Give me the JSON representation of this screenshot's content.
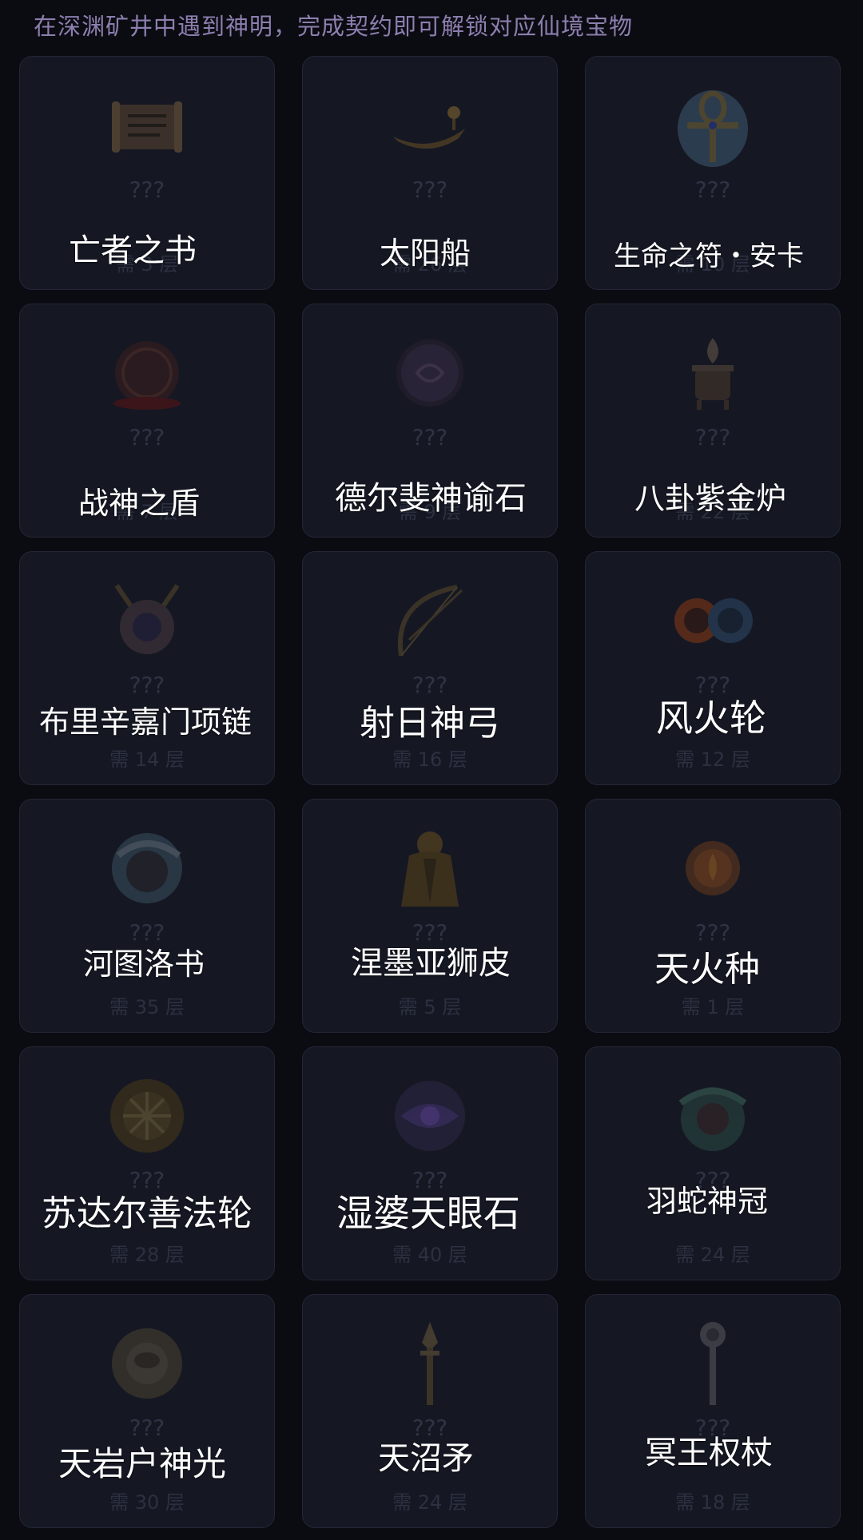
{
  "subtitle": "在深渊矿井中遇到神明，完成契约即可解锁对应仙境宝物",
  "items": [
    {
      "name": "亡者之书",
      "hidden": "???",
      "requirement": "需 3 层",
      "icon": "scroll-icon"
    },
    {
      "name": "太阳船",
      "hidden": "???",
      "requirement": "需 26 层",
      "icon": "sun-boat-icon"
    },
    {
      "name": "生命之符・安卡",
      "hidden": "???",
      "requirement": "需 10 层",
      "icon": "ankh-icon"
    },
    {
      "name": "战神之盾",
      "hidden": "???",
      "requirement": "需 7 层",
      "icon": "shield-icon"
    },
    {
      "name": "德尔斐神谕石",
      "hidden": "???",
      "requirement": "需 9 层",
      "icon": "oracle-stone-icon"
    },
    {
      "name": "八卦紫金炉",
      "hidden": "???",
      "requirement": "需 22 层",
      "icon": "furnace-icon"
    },
    {
      "name": "布里辛嘉门项链",
      "hidden": "???",
      "requirement": "需 14 层",
      "icon": "necklace-icon"
    },
    {
      "name": "射日神弓",
      "hidden": "???",
      "requirement": "需 16 层",
      "icon": "bow-icon"
    },
    {
      "name": "风火轮",
      "hidden": "???",
      "requirement": "需 12 层",
      "icon": "fire-wheel-icon"
    },
    {
      "name": "河图洛书",
      "hidden": "???",
      "requirement": "需 35 层",
      "icon": "hetu-icon"
    },
    {
      "name": "涅墨亚狮皮",
      "hidden": "???",
      "requirement": "需 5 层",
      "icon": "lion-pelt-icon"
    },
    {
      "name": "天火种",
      "hidden": "???",
      "requirement": "需 1 层",
      "icon": "fire-seed-icon"
    },
    {
      "name": "苏达尔善法轮",
      "hidden": "???",
      "requirement": "需 28 层",
      "icon": "dharma-wheel-icon"
    },
    {
      "name": "湿婆天眼石",
      "hidden": "???",
      "requirement": "需 40 层",
      "icon": "eye-stone-icon"
    },
    {
      "name": "羽蛇神冠",
      "hidden": "???",
      "requirement": "需 24 层",
      "icon": "serpent-crown-icon"
    },
    {
      "name": "天岩户神光",
      "hidden": "???",
      "requirement": "需 30 层",
      "icon": "divine-light-icon"
    },
    {
      "name": "天沼矛",
      "hidden": "???",
      "requirement": "需 24 层",
      "icon": "spear-icon"
    },
    {
      "name": "冥王权杖",
      "hidden": "???",
      "requirement": "需 18 层",
      "icon": "scepter-icon"
    }
  ],
  "colors": {
    "background": "#0b0b12",
    "card": "#151823",
    "subtitle": "#8c7fae"
  }
}
